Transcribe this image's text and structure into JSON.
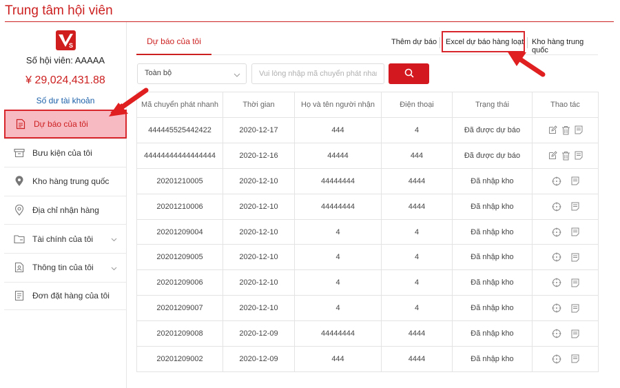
{
  "header": {
    "title": "Trung tâm hội viên"
  },
  "sidebar": {
    "member_no": "Số hội viên: AAAAA",
    "balance": "¥ 29,024,431.88",
    "balance_link": "Số dư tài khoản",
    "items": [
      {
        "label": "Dự báo của tôi",
        "icon": "document-icon",
        "active": true
      },
      {
        "label": "Bưu kiện của tôi",
        "icon": "box-icon"
      },
      {
        "label": "Kho hàng trung quốc",
        "icon": "location-pin-icon"
      },
      {
        "label": "Địa chỉ nhận hàng",
        "icon": "location-pin-icon"
      },
      {
        "label": "Tài chính của tôi",
        "icon": "folder-icon",
        "expandable": true
      },
      {
        "label": "Thông tin của tôi",
        "icon": "user-icon",
        "expandable": true
      },
      {
        "label": "Đơn đặt hàng của tôi",
        "icon": "document-icon"
      }
    ]
  },
  "tabs": {
    "active": "Dự báo của tôi",
    "add_forecast": "Thêm dự báo",
    "excel_forecast": "Excel dự báo hàng loạt",
    "china_warehouse": "Kho hàng trung quốc"
  },
  "filter": {
    "select_value": "Toàn bộ",
    "search_placeholder": "Vui lòng nhập mã chuyển phát nhanh"
  },
  "table": {
    "columns": [
      "Mã chuyển phát nhanh",
      "Thời gian",
      "Họ và tên người nhận",
      "Điện thoại",
      "Trạng thái",
      "Thao tác"
    ],
    "rows": [
      {
        "code": "444445525442422",
        "time": "2020-12-17",
        "name": "444",
        "phone": "4",
        "status": "Đã được dự báo",
        "actions": "edit"
      },
      {
        "code": "44444444444444444",
        "time": "2020-12-16",
        "name": "44444",
        "phone": "444",
        "status": "Đã được dự báo",
        "actions": "edit"
      },
      {
        "code": "20201210005",
        "time": "2020-12-10",
        "name": "44444444",
        "phone": "4444",
        "status": "Đã nhập kho",
        "actions": "view"
      },
      {
        "code": "20201210006",
        "time": "2020-12-10",
        "name": "44444444",
        "phone": "4444",
        "status": "Đã nhập kho",
        "actions": "view"
      },
      {
        "code": "20201209004",
        "time": "2020-12-10",
        "name": "4",
        "phone": "4",
        "status": "Đã nhập kho",
        "actions": "view"
      },
      {
        "code": "20201209005",
        "time": "2020-12-10",
        "name": "4",
        "phone": "4",
        "status": "Đã nhập kho",
        "actions": "view"
      },
      {
        "code": "20201209006",
        "time": "2020-12-10",
        "name": "4",
        "phone": "4",
        "status": "Đã nhập kho",
        "actions": "view"
      },
      {
        "code": "20201209007",
        "time": "2020-12-10",
        "name": "4",
        "phone": "4",
        "status": "Đã nhập kho",
        "actions": "view"
      },
      {
        "code": "20201209008",
        "time": "2020-12-09",
        "name": "44444444",
        "phone": "4444",
        "status": "Đã nhập kho",
        "actions": "view"
      },
      {
        "code": "20201209002",
        "time": "2020-12-09",
        "name": "444",
        "phone": "4444",
        "status": "Đã nhập kho",
        "actions": "view"
      }
    ]
  },
  "colors": {
    "accent": "#cc1f1f",
    "active_bg": "#f7b9c2",
    "link": "#1a5fa8"
  }
}
